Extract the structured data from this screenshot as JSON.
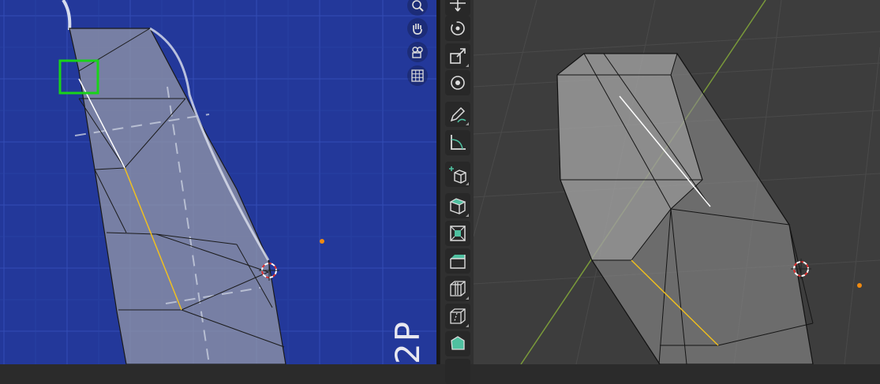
{
  "left_viewport": {
    "side_label": "2P"
  },
  "navigation": {
    "zoom": "zoom-icon",
    "pan": "hand-icon",
    "camera": "camera-icon",
    "ortho": "grid-icon"
  },
  "toolbar": {
    "tools": [
      "move-tool",
      "rotate-tool",
      "scale-tool",
      "transform-tool",
      "annotate-tool",
      "measure-tool",
      "add-cube-tool",
      "extrude-tool",
      "inset-tool",
      "bevel-tool",
      "loop-cut-tool",
      "knife-tool",
      "poly-build-tool"
    ]
  },
  "colors": {
    "ortho_background": "#23389a",
    "persp_background": "#3d3d3d",
    "selection_box": "#19d319",
    "highlight_edge": "#f0c020",
    "selected_edge": "#ffffff",
    "origin_dot": "#f08a10"
  }
}
